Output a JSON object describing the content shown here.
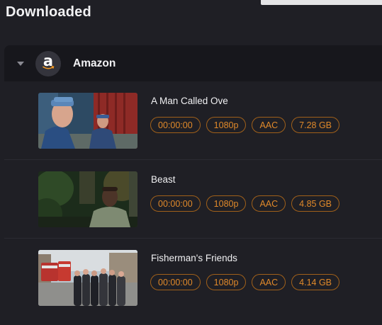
{
  "page": {
    "title": "Downloaded"
  },
  "provider": {
    "name": "Amazon",
    "logo_letter": "a",
    "icon": "amazon-logo-icon"
  },
  "items": [
    {
      "title": "A Man Called Ove",
      "duration": "00:00:00",
      "resolution": "1080p",
      "audio": "AAC",
      "size": "7.28 GB"
    },
    {
      "title": "Beast",
      "duration": "00:00:00",
      "resolution": "1080p",
      "audio": "AAC",
      "size": "4.85 GB"
    },
    {
      "title": "Fisherman's Friends",
      "duration": "00:00:00",
      "resolution": "1080p",
      "audio": "AAC",
      "size": "4.14 GB"
    }
  ],
  "colors": {
    "tag_text": "#e0892a",
    "tag_border": "#a0601a",
    "background": "#1f1f25",
    "header_background": "#17171c"
  }
}
